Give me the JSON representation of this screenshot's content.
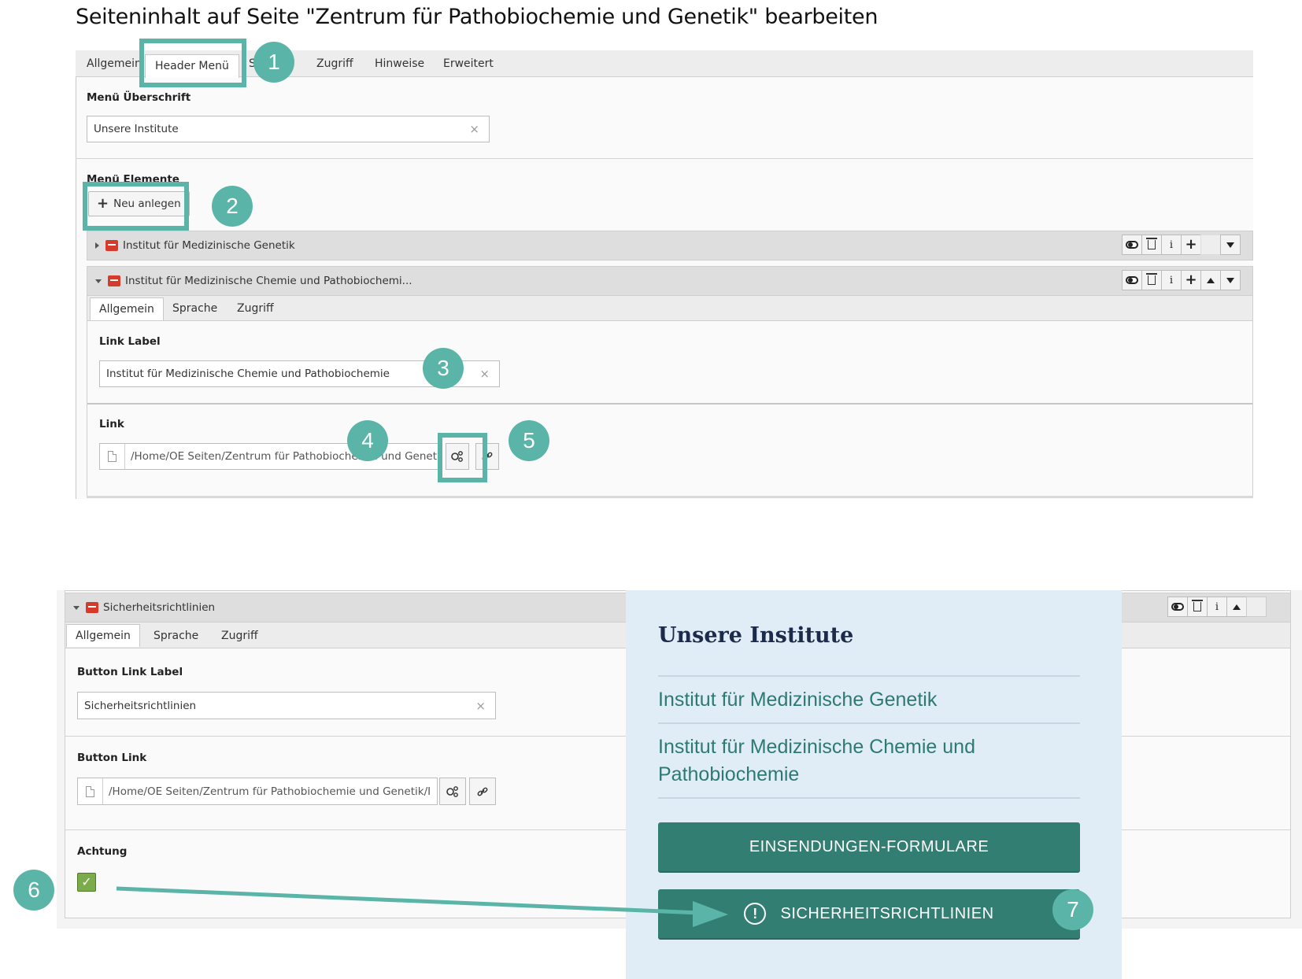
{
  "page_title": "Seiteninhalt auf Seite \"Zentrum für Pathobiochemie und Genetik\" bearbeiten",
  "main_tabs": [
    {
      "label": "Allgemein"
    },
    {
      "label": "Header Menü"
    },
    {
      "label": "S"
    },
    {
      "label": "Zugriff"
    },
    {
      "label": "Hinweise"
    },
    {
      "label": "Erweitert"
    }
  ],
  "menu_heading": {
    "label": "Menü Überschrift",
    "value": "Unsere Institute"
  },
  "menu_elements": {
    "label": "Menü Elemente",
    "new_button": "Neu anlegen"
  },
  "records": [
    {
      "title": "Institut für Medizinische Genetik"
    },
    {
      "title": "Institut für Medizinische Chemie und Pathobiochemi..."
    }
  ],
  "record_tabs": [
    "Allgemein",
    "Sprache",
    "Zugriff"
  ],
  "link_label": {
    "label": "Link Label",
    "value": "Institut für Medizinische Chemie und Pathobiochemie"
  },
  "link": {
    "label": "Link",
    "value": "/Home/OE Seiten/Zentrum für Pathobiochemie und Genetik/"
  },
  "icon_labels": {
    "info": "i",
    "clear": "×",
    "check": "✓",
    "warn": "!"
  },
  "badges": [
    "1",
    "2",
    "3",
    "4",
    "5",
    "6",
    "7"
  ],
  "bottom_record": {
    "title": "Sicherheitsrichtlinien",
    "tabs": [
      "Allgemein",
      "Sprache",
      "Zugriff"
    ],
    "button_link_label": {
      "label": "Button Link Label",
      "value": "Sicherheitsrichtlinien"
    },
    "button_link": {
      "label": "Button Link",
      "value": "/Home/OE Seiten/Zentrum für Pathobiochemie und Genetik/I"
    },
    "achtung": {
      "label": "Achtung",
      "checked": true
    }
  },
  "preview": {
    "title": "Unsere Institute",
    "links": [
      "Institut für Medizinische Genetik",
      "Institut für Medizinische Chemie und Pathobiochemie"
    ],
    "buttons": [
      "EINSENDUNGEN-FORMULARE",
      "SICHERHEITSRICHTLINIEN"
    ]
  },
  "colors": {
    "accent_teal": "#5ab5a8",
    "button_green": "#337e72",
    "preview_bg": "#e1edf6",
    "record_icon_red": "#d63a2a"
  }
}
